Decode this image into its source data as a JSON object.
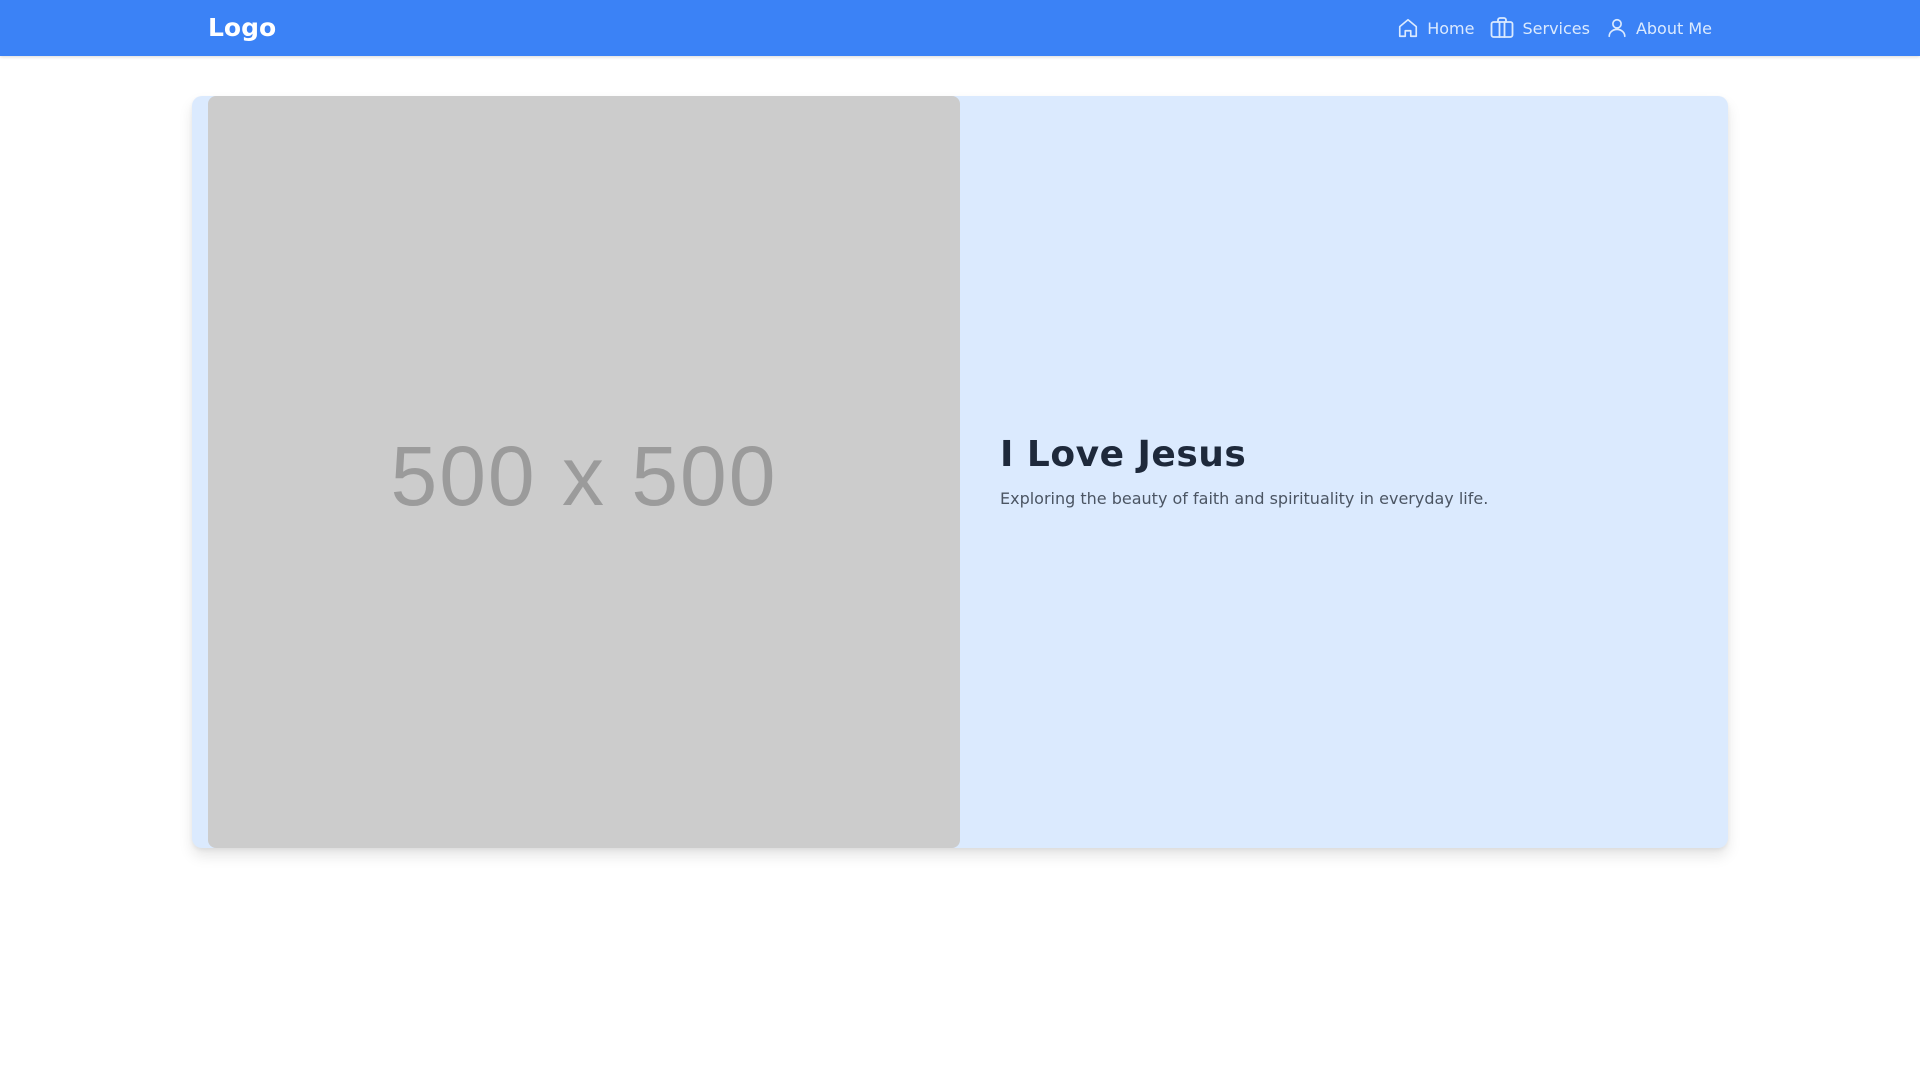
{
  "navbar": {
    "logo": "Logo",
    "background_color": "#3b82f6",
    "items": [
      {
        "label": "Home",
        "icon": "home-icon"
      },
      {
        "label": "Services",
        "icon": "briefcase-icon"
      },
      {
        "label": "About Me",
        "icon": "user-icon"
      }
    ]
  },
  "hero": {
    "background_color": "#dbeafe",
    "image_placeholder": "500 x 500",
    "title": "I Love Jesus",
    "subtitle": "Exploring the beauty of faith and spirituality in everyday life."
  }
}
